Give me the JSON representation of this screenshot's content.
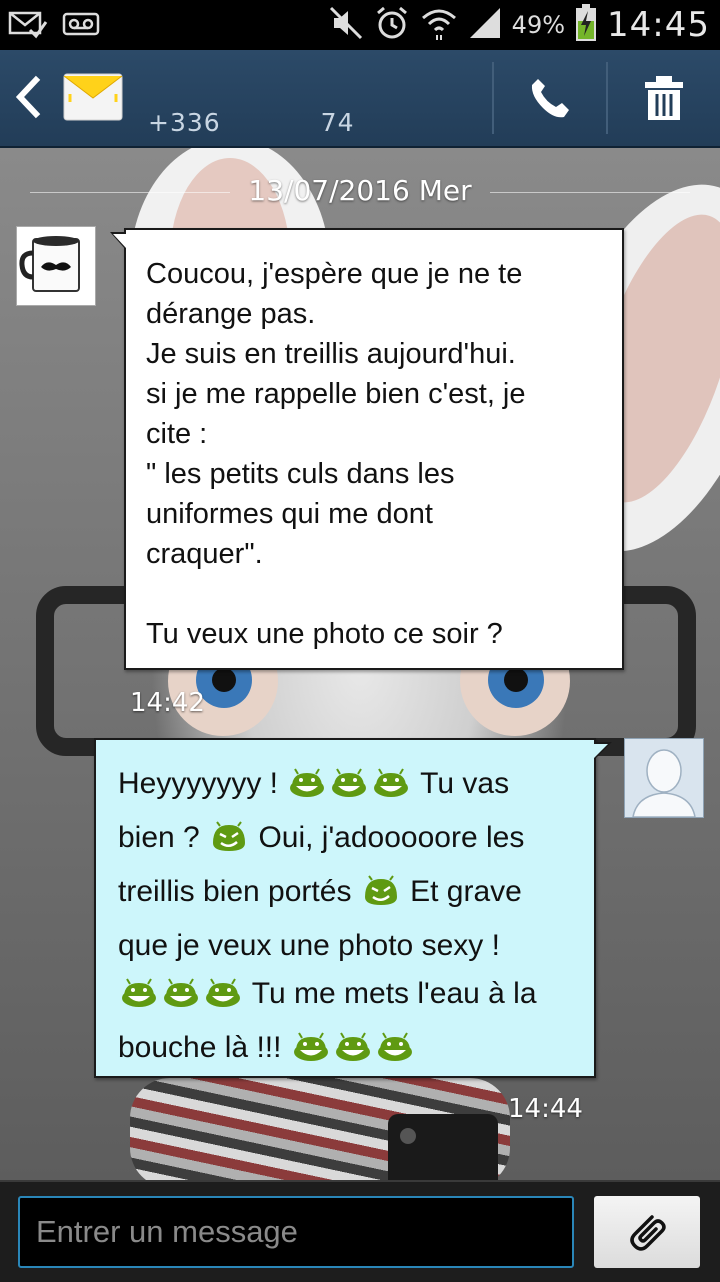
{
  "status_bar": {
    "battery_percent": "49%",
    "time": "14:45",
    "icons": [
      "email-check-icon",
      "voicemail-icon",
      "mute-icon",
      "alarm-icon",
      "wifi-icon",
      "signal-icon",
      "battery-charging-icon"
    ]
  },
  "header": {
    "contact_number_part1": "+336",
    "contact_number_part2": "74",
    "icons": [
      "back-icon",
      "messaging-app-icon",
      "call-icon",
      "trash-icon"
    ]
  },
  "conversation": {
    "date": "13/07/2016 Mer",
    "incoming": {
      "lines": [
        "Coucou, j'espère que je ne te",
        "dérange pas.",
        "Je suis en treillis aujourd'hui.",
        "si je me rappelle bien c'est, je",
        "cite :",
        "\" les petits culs dans les",
        "uniformes qui me dont",
        "craquer\".",
        "",
        "Tu veux une photo ce soir ?"
      ],
      "time": "14:42"
    },
    "outgoing": {
      "line1_a": "Heyyyyyyy !",
      "line1_b": "Tu vas",
      "line2_a": "bien ?",
      "line2_b": "Oui, j'adooooore les",
      "line3_a": "treillis bien portés",
      "line3_b": "Et grave",
      "line4": "que je veux une photo sexy !",
      "line5_b": "Tu me mets l'eau à la",
      "line6_a": "bouche là !!!",
      "emoji_color": "#5f9a12",
      "time": "14:44"
    }
  },
  "compose": {
    "placeholder": "Entrer un message",
    "value": ""
  }
}
